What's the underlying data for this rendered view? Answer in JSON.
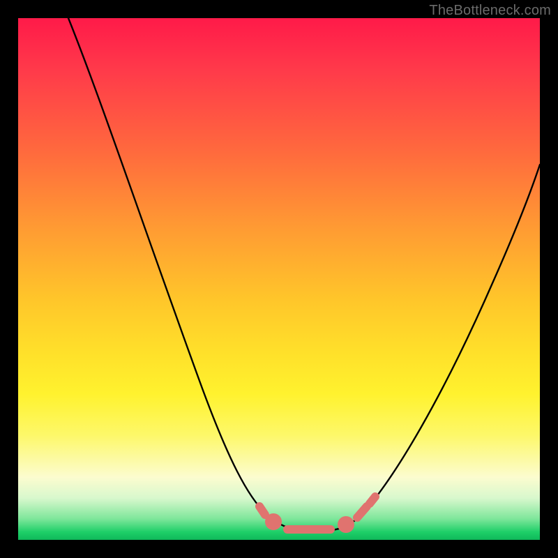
{
  "watermark": "TheBottleneck.com",
  "chart_data": {
    "type": "line",
    "title": "",
    "xlabel": "",
    "ylabel": "",
    "ylim": [
      0,
      100
    ],
    "xlim": [
      0,
      100
    ],
    "series": [
      {
        "name": "bottleneck-curve",
        "x": [
          10,
          15,
          20,
          25,
          30,
          35,
          40,
          45,
          48,
          50,
          52,
          54,
          56,
          58,
          60,
          62,
          65,
          70,
          75,
          80,
          85,
          90,
          95,
          100
        ],
        "values": [
          100,
          88,
          76,
          64,
          53,
          42,
          32,
          20,
          12,
          8,
          5,
          3,
          2,
          2,
          3,
          5,
          9,
          16,
          24,
          32,
          40,
          48,
          55,
          62
        ]
      }
    ],
    "markers": {
      "name": "highlight-dots",
      "x": [
        48.5,
        50.5,
        52,
        54,
        56,
        58,
        60,
        62.5,
        64
      ],
      "values": [
        11,
        7,
        5,
        3,
        2,
        2,
        3,
        6,
        9
      ],
      "color": "#e0736f"
    },
    "background_gradient": {
      "top": "#ff1a49",
      "mid_high": "#ff9a33",
      "mid": "#fff22e",
      "mid_low": "#fcfccf",
      "bottom": "#1ecf68"
    }
  }
}
